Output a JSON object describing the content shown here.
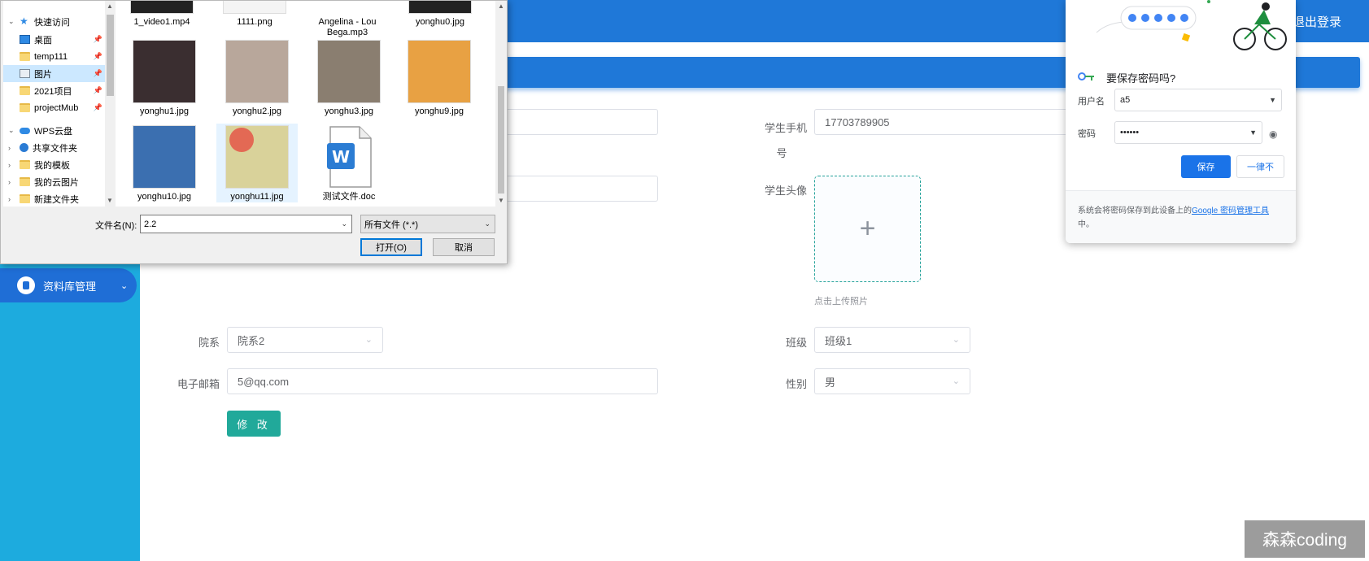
{
  "app": {
    "logout_label": "退出登录",
    "nav_item_label": "资料库管理"
  },
  "form": {
    "phone_label_line1": "学生手机",
    "phone_label_line2": "号",
    "phone_value": "17703789905",
    "avatar_label": "学生头像",
    "upload_hint": "点击上传照片",
    "dept_label": "院系",
    "dept_value": "院系2",
    "class_label": "班级",
    "class_value": "班级1",
    "email_label": "电子邮箱",
    "email_value": "5@qq.com",
    "gender_label": "性别",
    "gender_value": "男",
    "submit_label": "修 改"
  },
  "file_dialog": {
    "tree": [
      {
        "label": "快速访问",
        "icon": "star-icon",
        "expanded": true
      },
      {
        "label": "桌面",
        "icon": "desktop-icon",
        "pinned": true
      },
      {
        "label": "temp111",
        "icon": "folder-icon",
        "pinned": true
      },
      {
        "label": "图片",
        "icon": "picture-icon",
        "pinned": true,
        "selected": true
      },
      {
        "label": "2021项目",
        "icon": "folder-icon",
        "pinned": true
      },
      {
        "label": "projectMub",
        "icon": "folder-icon",
        "pinned": true
      },
      {
        "label": "WPS云盘",
        "icon": "cloud-icon",
        "expanded": true
      },
      {
        "label": "共享文件夹",
        "icon": "share-icon"
      },
      {
        "label": "我的模板",
        "icon": "folder-icon"
      },
      {
        "label": "我的云图片",
        "icon": "folder-icon"
      },
      {
        "label": "新建文件夹",
        "icon": "folder-icon"
      }
    ],
    "files_row0": [
      "1_video1.mp4",
      "1111.png",
      "Angelina - Lou Bega.mp3",
      "yonghu0.jpg"
    ],
    "files": [
      {
        "name": "yonghu1.jpg",
        "thumb_color": "#3a2e30"
      },
      {
        "name": "yonghu2.jpg",
        "thumb_color": "#b8a79b"
      },
      {
        "name": "yonghu3.jpg",
        "thumb_color": "#8a7e70"
      },
      {
        "name": "yonghu9.jpg",
        "thumb_color": "#e8a143"
      },
      {
        "name": "yonghu10.jpg",
        "thumb_color": "#3b6fb0"
      },
      {
        "name": "yonghu11.jpg",
        "thumb_color": "#d9d29a",
        "selected": true
      },
      {
        "name": "测试文件.doc",
        "thumb_color": "#ffffff"
      }
    ],
    "filename_label": "文件名(N):",
    "filename_value": "2.2",
    "filetype_value": "所有文件 (*.*)",
    "open_label": "打开(O)",
    "cancel_label": "取消"
  },
  "password_popup": {
    "title": "要保存密码吗?",
    "username_label": "用户名",
    "username_value": "a5",
    "password_label": "密码",
    "password_value": "••••••",
    "save_label": "保存",
    "never_label": "一律不",
    "footer_text": "系统会将密码保存到此设备上的",
    "footer_link": "Google 密码管理工具",
    "footer_suffix": "中。"
  },
  "watermark": "森森coding"
}
